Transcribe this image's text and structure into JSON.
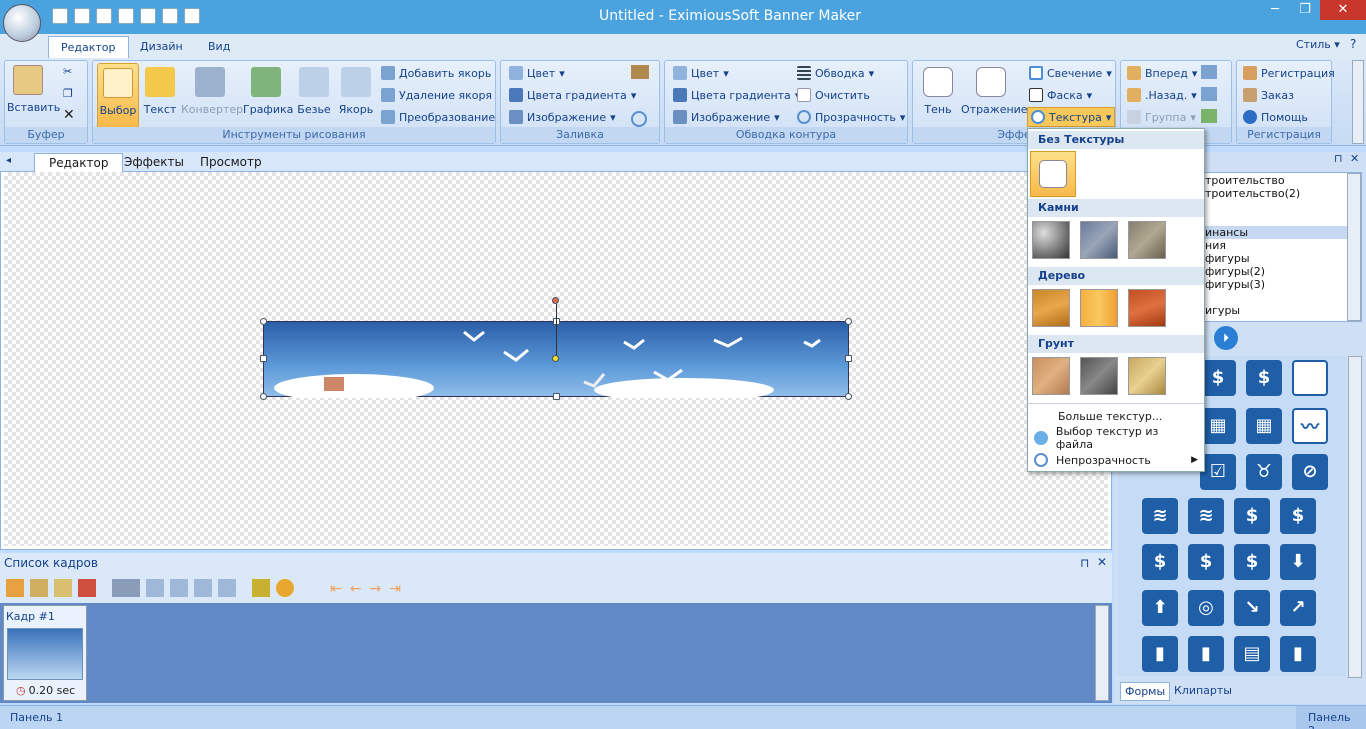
{
  "window": {
    "title": "Untitled - EximiousSoft Banner Maker",
    "minimize": "─",
    "maximize": "❐",
    "close": "✕"
  },
  "ribbon_tabs": [
    "Редактор",
    "Дизайн",
    "Вид"
  ],
  "style_menu": "Стиль",
  "groups": {
    "buffer": {
      "caption": "Буфер",
      "paste": "Вставить"
    },
    "draw": {
      "caption": "Инструменты рисования",
      "select": "Выбор",
      "text": "Текст",
      "converter": "Конвертер",
      "graphics": "Графика",
      "bezier": "Безье",
      "anchor": "Якорь",
      "add_anchor": "Добавить якорь",
      "del_anchor": "Удаление якоря",
      "transform": "Преобразование"
    },
    "fill": {
      "caption": "Заливка",
      "color": "Цвет",
      "gradient": "Цвета градиента",
      "image": "Изображение"
    },
    "outline": {
      "caption": "Обводка контура",
      "color": "Цвет",
      "gradient": "Цвета градиента",
      "image": "Изображение",
      "stroke": "Обводка",
      "clear": "Очистить",
      "transparency": "Прозрачность"
    },
    "effects": {
      "caption": "Эффе",
      "shadow": "Тень",
      "reflection": "Отражение",
      "glow": "Свечение",
      "bevel": "Фаска",
      "texture": "Текстура"
    },
    "arrange": {
      "caption": "е",
      "forward": "Вперед",
      "back": ".Назад.",
      "group": "Группа"
    },
    "registration": {
      "caption": "Регистрация",
      "register": "Регистрация",
      "order": "Заказ",
      "help": "Помощь"
    }
  },
  "doc_tabs": [
    "Редактор",
    "Эффекты",
    "Просмотр"
  ],
  "frames": {
    "title": "Список кадров",
    "frame_label": "Кадр #1",
    "frame_time": "0.20 sec"
  },
  "texture_menu": {
    "none": "Без Текстуры",
    "stones": "Камни",
    "wood": "Дерево",
    "soil": "Грунт",
    "more": "Больше текстур...",
    "from_file": "Выбор текстур из файла",
    "opacity": "Непрозрачность"
  },
  "right_list": [
    "троительство",
    "троительство(2)",
    "",
    "инансы",
    "ния",
    "фигуры",
    "фигуры(2)",
    "фигуры(3)",
    "",
    "игуры"
  ],
  "right_tabs": [
    "Формы",
    "Клипарты"
  ],
  "status": {
    "left": "Панель 1",
    "right": "Панель 2"
  },
  "colors": {
    "titlebar": "#4aa3df",
    "ribbon": "#dbe8f8",
    "accent": "#f6b94a",
    "frames_bg": "#6189c6"
  }
}
